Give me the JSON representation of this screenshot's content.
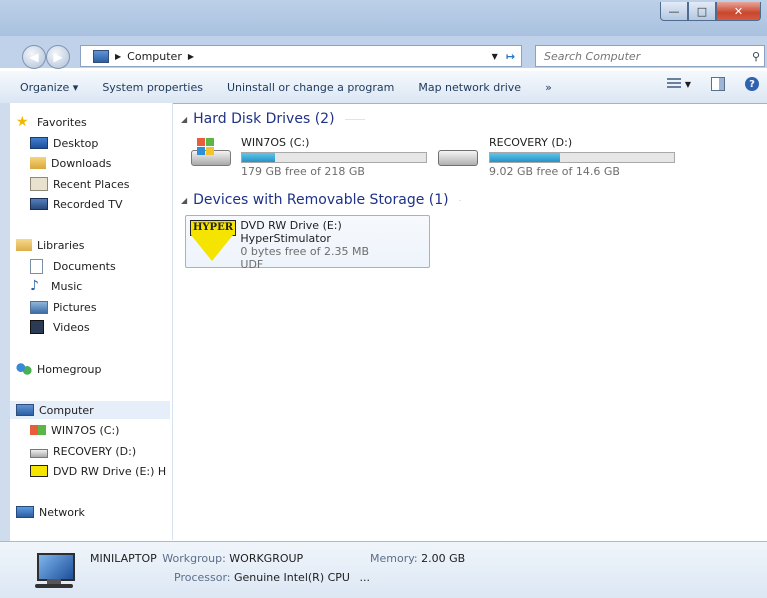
{
  "address": {
    "breadcrumb": "Computer",
    "search_placeholder": "Search Computer"
  },
  "toolbar": {
    "organize": "Organize ▾",
    "system_properties": "System properties",
    "uninstall": "Uninstall or change a program",
    "map_drive": "Map network drive",
    "more": "»"
  },
  "nav": {
    "favorites": "Favorites",
    "desktop": "Desktop",
    "downloads": "Downloads",
    "recent_places": "Recent Places",
    "recorded_tv": "Recorded TV",
    "libraries": "Libraries",
    "documents": "Documents",
    "music": "Music",
    "pictures": "Pictures",
    "videos": "Videos",
    "homegroup": "Homegroup",
    "computer": "Computer",
    "win7os": "WIN7OS (C:)",
    "recovery": "RECOVERY (D:)",
    "dvd": "DVD RW Drive (E:) H",
    "network": "Network"
  },
  "groups": {
    "hdd": "Hard Disk Drives (2)",
    "removable": "Devices with Removable Storage (1)"
  },
  "drives": {
    "c": {
      "name": "WIN7OS (C:)",
      "free": "179 GB free of 218 GB",
      "used_fraction": 0.18
    },
    "d": {
      "name": "RECOVERY (D:)",
      "free": "9.02 GB free of 14.6 GB",
      "used_fraction": 0.38
    },
    "e": {
      "name": "DVD RW Drive (E:) HyperStimulator",
      "free": "0 bytes free of 2.35 MB",
      "fs": "UDF",
      "logo_text": "HYPER"
    }
  },
  "details": {
    "computer_name": "MINILAPTOP",
    "workgroup_label": "Workgroup:",
    "workgroup_value": "WORKGROUP",
    "memory_label": "Memory:",
    "memory_value": "2.00 GB",
    "processor_label": "Processor:",
    "processor_value": "Genuine Intel(R) CPU",
    "processor_more": "..."
  },
  "colors": {
    "accent": "#1e3287",
    "bar_fill": "#2792c4"
  }
}
